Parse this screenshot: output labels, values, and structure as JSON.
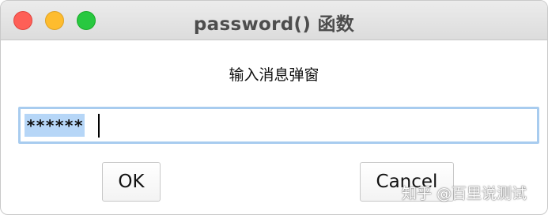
{
  "window": {
    "title": "password() 函数",
    "controls": {
      "close_icon": "traffic-light-close",
      "minimize_icon": "traffic-light-minimize",
      "maximize_icon": "traffic-light-maximize",
      "close_color": "#fe5f57",
      "minimize_color": "#febc2e",
      "maximize_color": "#28c840"
    }
  },
  "dialog": {
    "message": "输入消息弹窗",
    "password_field": {
      "value": "******",
      "selected": true,
      "focus_border_color": "#a8ccef",
      "selection_color": "#b6d6f7"
    },
    "ok_label": "OK",
    "cancel_label": "Cancel"
  },
  "watermark": {
    "text": "知乎 @百里说测试"
  }
}
